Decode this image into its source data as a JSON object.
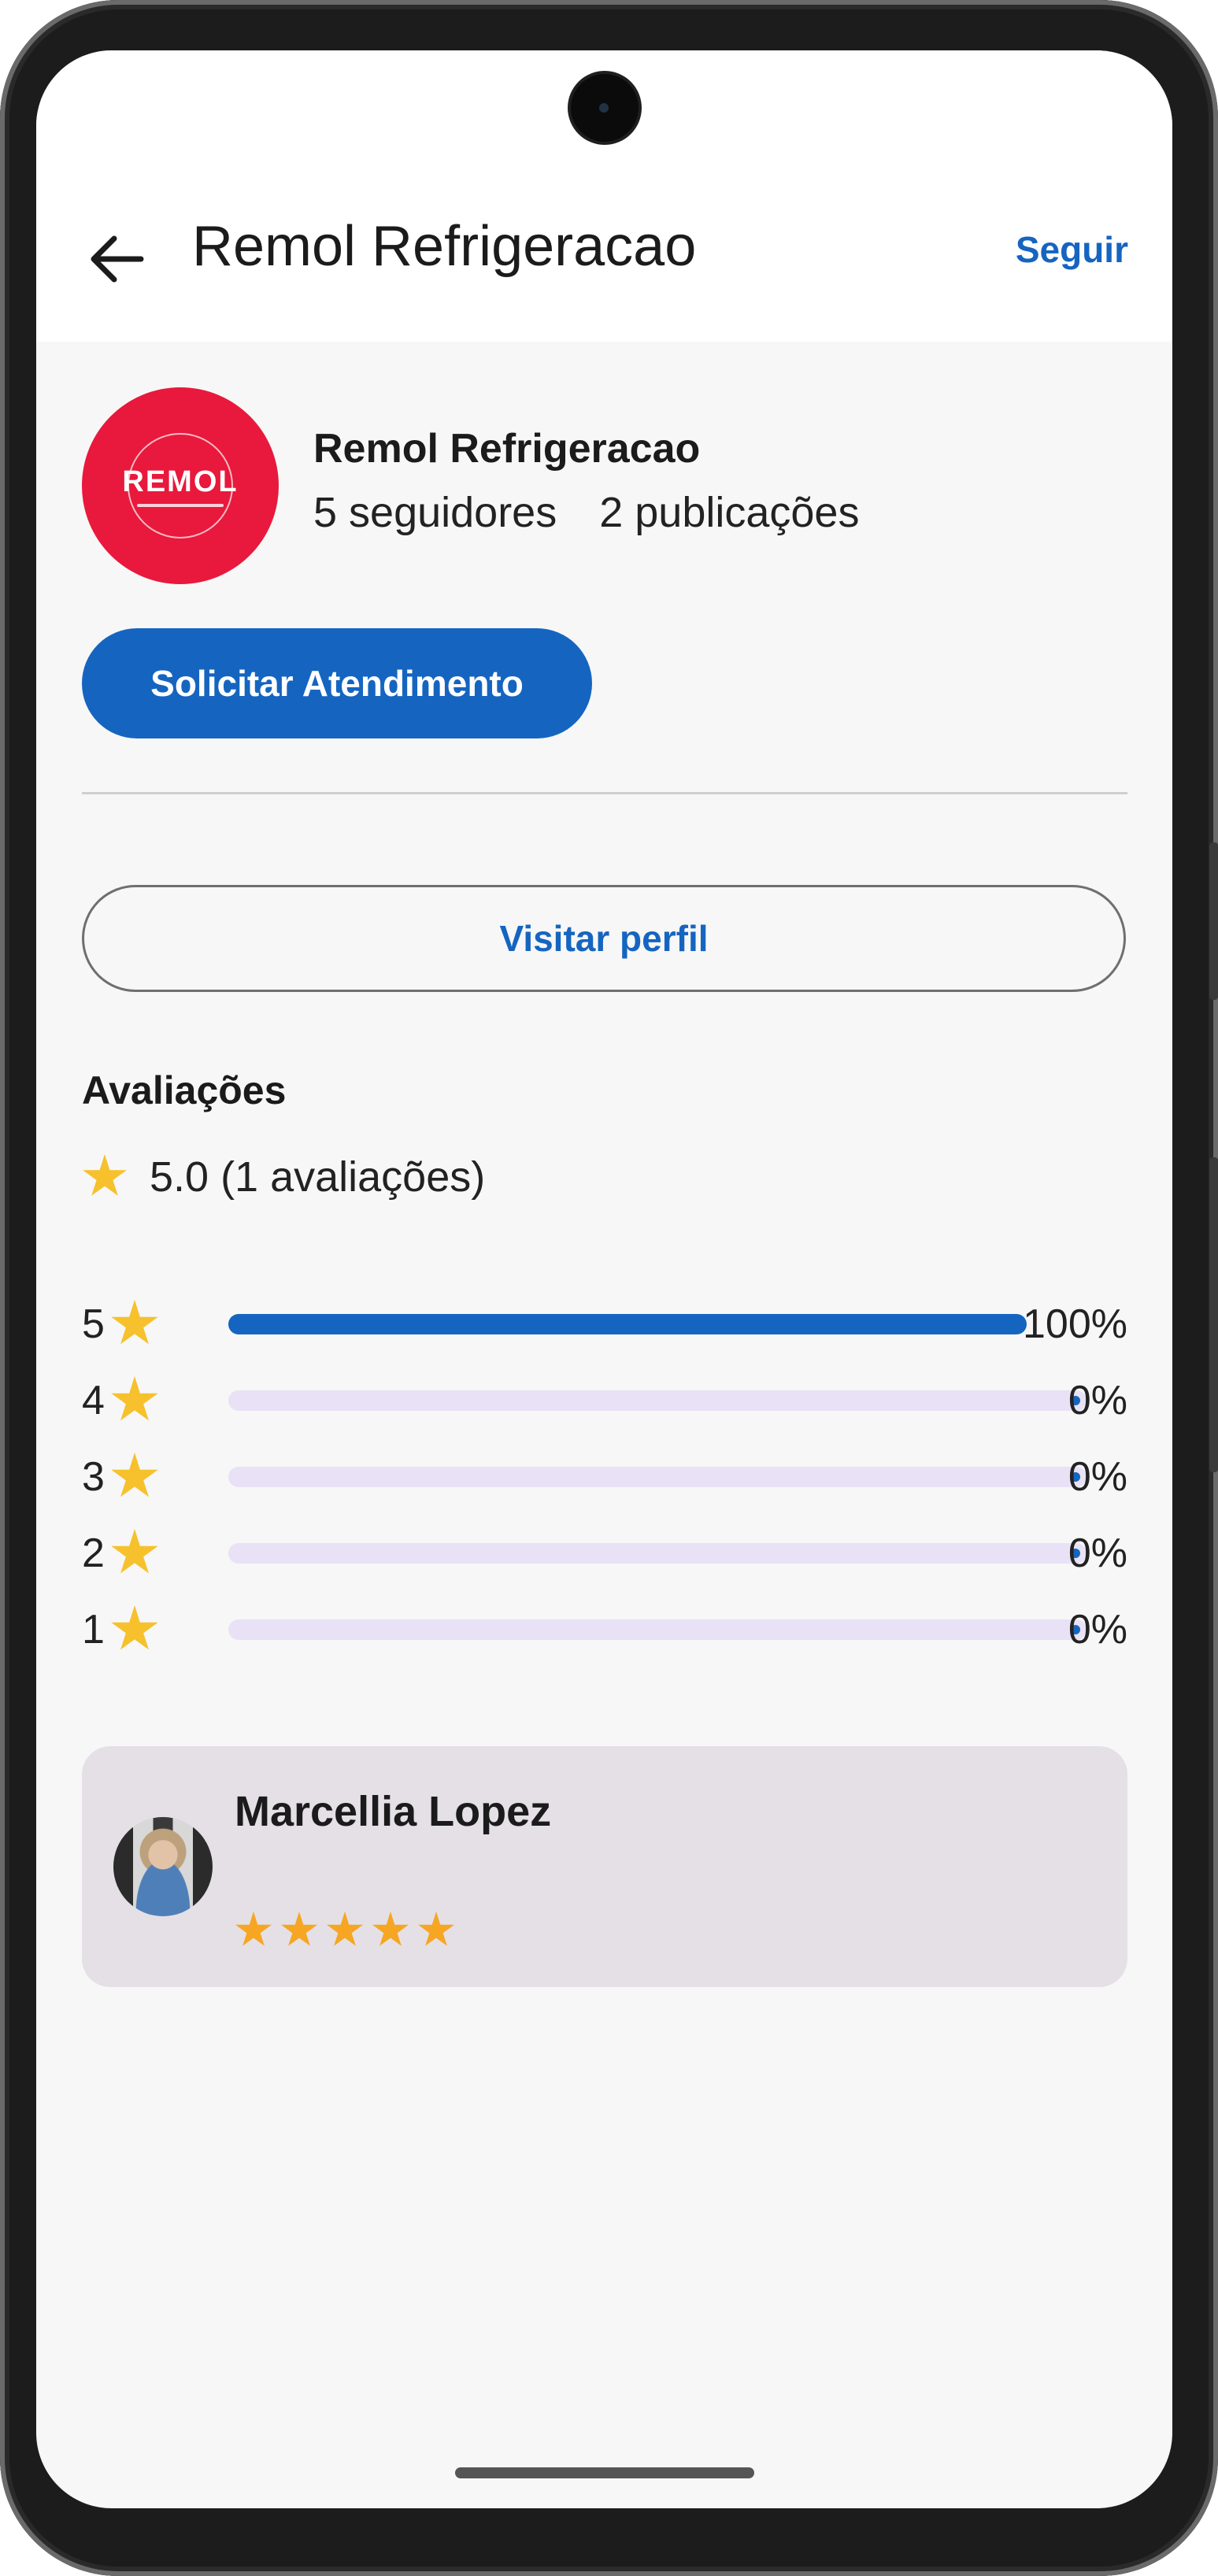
{
  "header": {
    "title": "Remol Refrigeracao",
    "follow_label": "Seguir"
  },
  "profile": {
    "logo_text": "REMOL",
    "name": "Remol Refrigeracao",
    "followers": "5 seguidores",
    "posts": "2 publicações",
    "primary_action": "Solicitar Atendimento",
    "visit_profile": "Visitar perfil"
  },
  "ratings": {
    "section_title": "Avaliações",
    "summary": "5.0 (1 avaliações)",
    "rows": [
      {
        "stars": "5",
        "percent_label": "100%",
        "fraction": 1.0
      },
      {
        "stars": "4",
        "percent_label": "0%",
        "fraction": 0.0
      },
      {
        "stars": "3",
        "percent_label": "0%",
        "fraction": 0.0
      },
      {
        "stars": "2",
        "percent_label": "0%",
        "fraction": 0.0
      },
      {
        "stars": "1",
        "percent_label": "0%",
        "fraction": 0.0
      }
    ]
  },
  "review": {
    "author": "Marcellia Lopez",
    "rating": 5
  },
  "colors": {
    "accent": "#1565c0",
    "logo_bg": "#e8193c",
    "star": "#f6c12c",
    "track": "#e9e1f5"
  }
}
